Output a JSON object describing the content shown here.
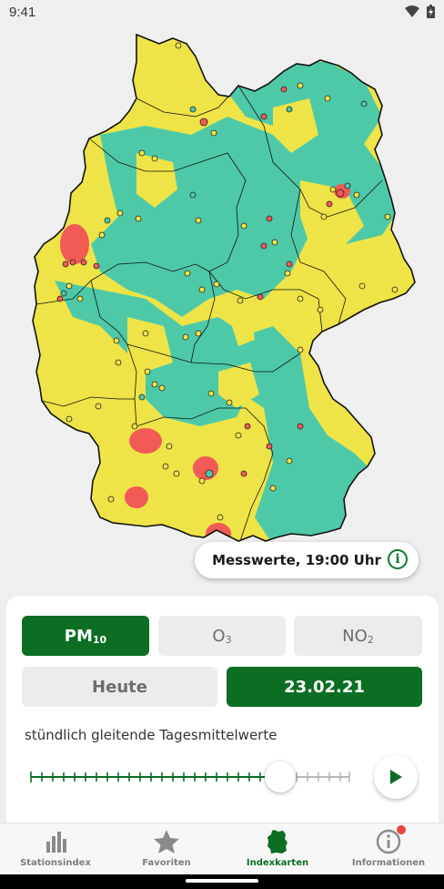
{
  "status": {
    "time": "9:41"
  },
  "map": {
    "colors": {
      "good": "#4ec9a8",
      "moderate": "#eee447",
      "bad": "#f25a55",
      "border": "#111111",
      "background": "#efefef"
    }
  },
  "messwerte": {
    "label": "Messwerte, 19:00 Uhr",
    "info_icon": "info-icon"
  },
  "pollutants": [
    {
      "main": "PM",
      "sub": "10",
      "active": true
    },
    {
      "main": "O",
      "sub": "3",
      "active": false
    },
    {
      "main": "NO",
      "sub": "2",
      "active": false
    }
  ],
  "days": [
    {
      "label": "Heute",
      "active": false
    },
    {
      "label": "23.02.21",
      "active": true
    }
  ],
  "caption": "stündlich gleitende Tagesmittelwerte",
  "slider": {
    "value_fraction": 0.79
  },
  "nav": [
    {
      "label": "Stationsindex",
      "icon": "bar-chart-icon",
      "active": false
    },
    {
      "label": "Favoriten",
      "icon": "star-icon",
      "active": false
    },
    {
      "label": "Indexkarten",
      "icon": "germany-map-icon",
      "active": true
    },
    {
      "label": "Informationen",
      "icon": "info-icon",
      "active": false,
      "badge": true
    }
  ],
  "accent": "#0b6e23"
}
